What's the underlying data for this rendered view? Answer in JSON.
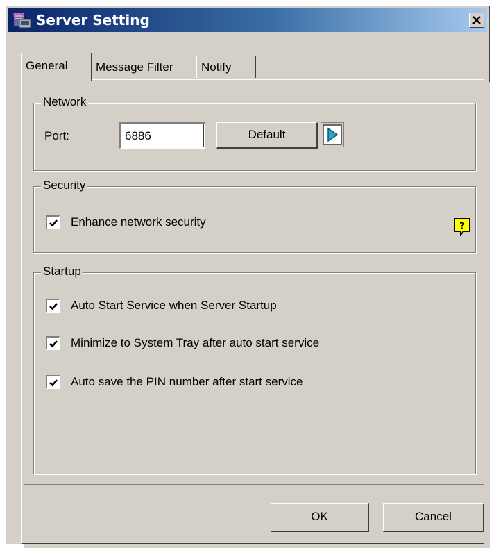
{
  "window": {
    "title": "Server Setting",
    "app_icon": "server-app-icon",
    "close_icon": "close-icon"
  },
  "tabs": [
    {
      "label": "General",
      "active": true
    },
    {
      "label": "Message Filter",
      "active": false
    },
    {
      "label": "Notify",
      "active": false
    }
  ],
  "network": {
    "title": "Network",
    "port_label": "Port:",
    "port_value": "6886",
    "default_button": "Default",
    "arrow_icon": "play-arrow-icon"
  },
  "security": {
    "title": "Security",
    "enhance_label": "Enhance network security",
    "enhance_checked": true,
    "help_icon": "help-icon"
  },
  "startup": {
    "title": "Startup",
    "options": [
      {
        "label": "Auto Start Service when Server Startup",
        "checked": true
      },
      {
        "label": "Minimize to System Tray after auto start service",
        "checked": true
      },
      {
        "label": "Auto save the PIN number after start service",
        "checked": true
      }
    ]
  },
  "footer": {
    "ok_button": "OK",
    "cancel_button": "Cancel"
  },
  "colors": {
    "dialog_face": "#d4d0c8",
    "titlebar_start": "#0a246a",
    "titlebar_end": "#a6caf0",
    "arrow_blue": "#2aa8c8",
    "help_yellow": "#ffff00"
  }
}
